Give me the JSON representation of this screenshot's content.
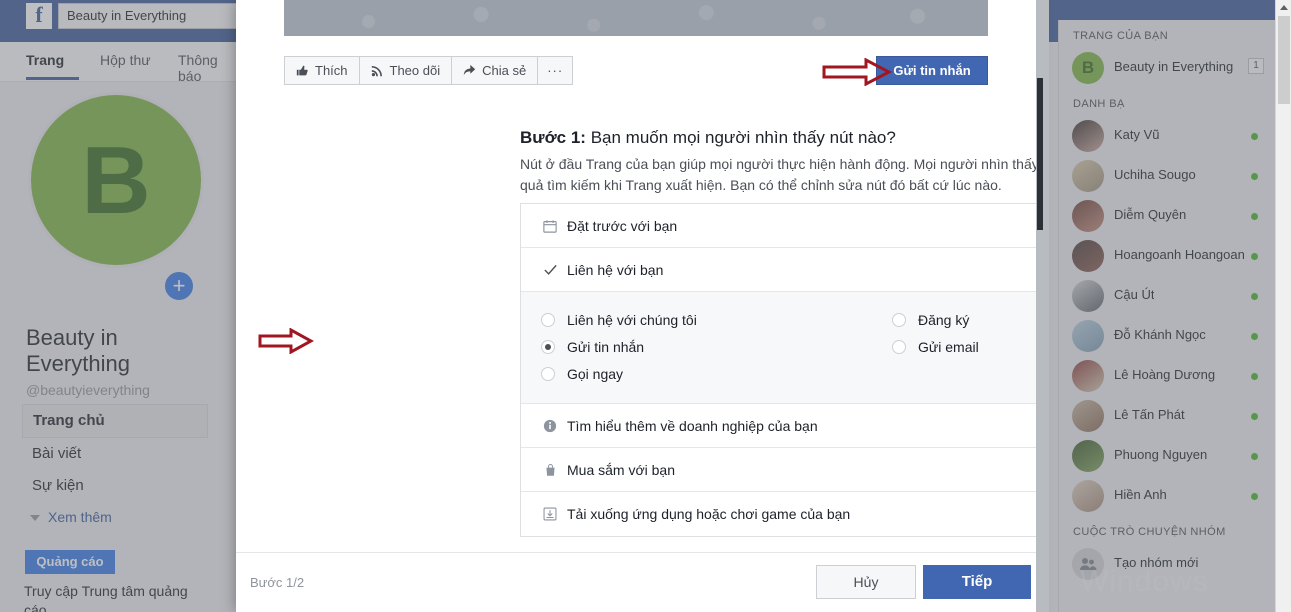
{
  "topbar": {
    "logo": "f",
    "search_value": "Beauty in Everything"
  },
  "left_sidebar": {
    "tabs": [
      {
        "label": "Trang",
        "active": true
      },
      {
        "label": "Hộp thư",
        "active": false
      },
      {
        "label": "Thông báo",
        "active": false
      }
    ],
    "avatar_letter": "B",
    "plus_icon": "+",
    "page_name": "Beauty in Everything",
    "page_handle": "@beautyieverything",
    "nav_items": [
      {
        "label": "Trang chủ",
        "selected": true
      },
      {
        "label": "Bài viết",
        "selected": false
      },
      {
        "label": "Sự kiện",
        "selected": false
      }
    ],
    "see_more": "Xem thêm",
    "ads_button": "Quảng cáo",
    "ads_note": "Truy cập Trung tâm quảng cáo"
  },
  "modal": {
    "action_pills": [
      {
        "label": "Thích",
        "icon": "thumbs-up-icon"
      },
      {
        "label": "Theo dõi",
        "icon": "rss-follow-icon"
      },
      {
        "label": "Chia sẻ",
        "icon": "share-arrow-icon"
      },
      {
        "label": "···",
        "icon": "ellipsis-icon"
      }
    ],
    "message_button": "Gửi tin nhắn",
    "step_title_bold": "Bước 1:",
    "step_title_rest": " Bạn muốn mọi người nhìn thấy nút nào?",
    "step_desc": "Nút ở đầu Trang của bạn giúp mọi người thực hiện hành động. Mọi người nhìn thấy nút trên Trang và trong kết quả tìm kiếm khi Trang xuất hiện. Bạn có thể chỉnh sửa nút đó bất cứ lúc nào.",
    "accordion": [
      {
        "label": "Đặt trước với bạn",
        "icon": "calendar-icon",
        "expanded": false
      },
      {
        "label": "Liên hệ với bạn",
        "icon": "check-icon",
        "expanded": true
      },
      {
        "label": "Tìm hiểu thêm về doanh nghiệp của bạn",
        "icon": "info-icon",
        "expanded": false
      },
      {
        "label": "Mua sắm với bạn",
        "icon": "shopping-bag-icon",
        "expanded": false
      },
      {
        "label": "Tải xuống ứng dụng hoặc chơi game của bạn",
        "icon": "download-icon",
        "expanded": false
      }
    ],
    "radio_left": [
      {
        "label": "Liên hệ với chúng tôi",
        "selected": false
      },
      {
        "label": "Gửi tin nhắn",
        "selected": true
      },
      {
        "label": "Gọi ngay",
        "selected": false
      }
    ],
    "radio_right": [
      {
        "label": "Đăng ký",
        "selected": false
      },
      {
        "label": "Gửi email",
        "selected": false
      }
    ],
    "footer": {
      "step_count": "Bước 1/2",
      "cancel": "Hủy",
      "next": "Tiếp"
    }
  },
  "right_sidebar": {
    "section_pages": "TRANG CỦA BẠN",
    "page_entry": {
      "name": "Beauty in Everything",
      "avatar_letter": "B",
      "badge": "1"
    },
    "section_contacts": "DANH BẠ",
    "contacts": [
      {
        "name": "Katy Vũ",
        "online": true,
        "av1": "#3a2f2b",
        "av2": "#c9a9a0"
      },
      {
        "name": "Uchiha Sougo",
        "online": true,
        "av1": "#d8c8a8",
        "av2": "#9a8f7a"
      },
      {
        "name": "Diễm Quyên",
        "online": true,
        "av1": "#6d4036",
        "av2": "#c08a7a"
      },
      {
        "name": "Hoangoanh Hoangoanh",
        "online": true,
        "av1": "#4a3b3a",
        "av2": "#8a5c4e"
      },
      {
        "name": "Cậu Út",
        "online": true,
        "av1": "#d0d3d6",
        "av2": "#5a5f66"
      },
      {
        "name": "Đỗ Khánh Ngọc",
        "online": true,
        "av1": "#b9cfe0",
        "av2": "#7a9ab0"
      },
      {
        "name": "Lê Hoàng Dương",
        "online": true,
        "av1": "#8c3b3b",
        "av2": "#d6c9b0"
      },
      {
        "name": "Lê Tấn Phát",
        "online": true,
        "av1": "#c4b5a0",
        "av2": "#8a6a55"
      },
      {
        "name": "Phuong Nguyen",
        "online": true,
        "av1": "#3c5a2a",
        "av2": "#7fa05a"
      },
      {
        "name": "Hiền Anh",
        "online": true,
        "av1": "#e0cfc0",
        "av2": "#a08a76"
      }
    ],
    "section_groups": "CUỘC TRÒ CHUYỆN NHÓM",
    "create_group": "Tạo nhóm mới"
  },
  "watermark": "Windows",
  "colors": {
    "fb_blue": "#3b5998",
    "primary_button": "#4267b2",
    "accent_link": "#385898",
    "online_green": "#42b72a",
    "annotation_red": "#a01722",
    "page_avatar_green": "#7cb342"
  }
}
